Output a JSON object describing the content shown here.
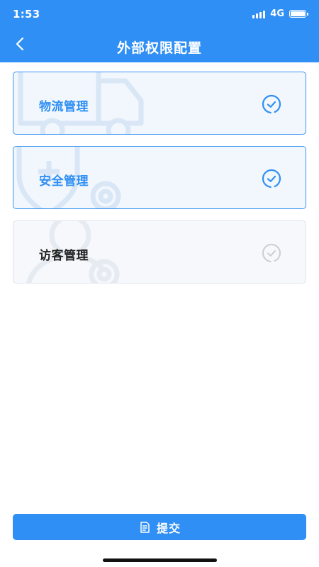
{
  "status_bar": {
    "time": "1:53",
    "network": "4G"
  },
  "nav": {
    "title": "外部权限配置",
    "back_icon": "chevron-left-icon"
  },
  "permissions": [
    {
      "label": "物流管理",
      "selected": true,
      "icon": "truck-icon"
    },
    {
      "label": "安全管理",
      "selected": true,
      "icon": "shield-icon"
    },
    {
      "label": "访客管理",
      "selected": false,
      "icon": "visitor-icon"
    }
  ],
  "submit": {
    "label": "提交",
    "icon": "document-icon"
  },
  "colors": {
    "primary": "#2f8ff4",
    "selected_bg": "#f2f7fd",
    "unselected_border": "#dfe4ea",
    "unselected_check": "#c9ced6"
  }
}
